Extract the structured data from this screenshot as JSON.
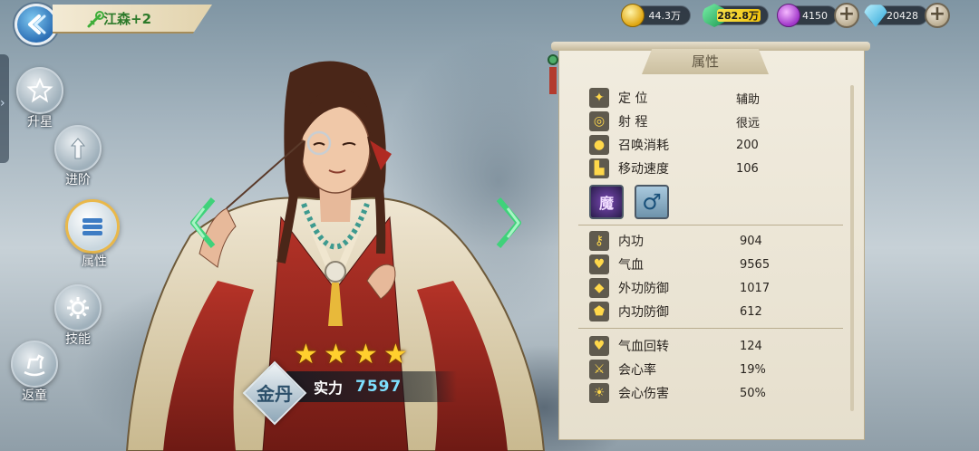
{
  "header": {
    "hero_name": "江森+2"
  },
  "currency": {
    "gold": "44.3万",
    "jade": "282.8万",
    "orb": "4150",
    "gem": "20428",
    "add_label": "+"
  },
  "side_nav": {
    "items": [
      {
        "label": "升星",
        "icon": "star-icon"
      },
      {
        "label": "进阶",
        "icon": "arrow-up-icon"
      },
      {
        "label": "属性",
        "icon": "list-icon",
        "active": true
      },
      {
        "label": "技能",
        "icon": "gear-icon"
      },
      {
        "label": "返童",
        "icon": "rocking-horse-icon"
      }
    ]
  },
  "hero": {
    "rank": "金丹",
    "stars": [
      "★",
      "★",
      "★",
      "★"
    ],
    "power_label": "实力",
    "power_value": "7597"
  },
  "panel": {
    "title": "属性",
    "basic": [
      {
        "key": "定 位",
        "value": "辅助",
        "icon": "role-icon"
      },
      {
        "key": "射 程",
        "value": "很远",
        "icon": "target-icon"
      },
      {
        "key": "召唤消耗",
        "value": "200",
        "icon": "drop-icon"
      },
      {
        "key": "移动速度",
        "value": "106",
        "icon": "boot-icon"
      }
    ],
    "tags": {
      "faction": "魔",
      "gender": "♂"
    },
    "combat": [
      {
        "key": "内功",
        "value": "904",
        "icon": "wand-icon"
      },
      {
        "key": "气血",
        "value": "9565",
        "icon": "heart-icon"
      },
      {
        "key": "外功防御",
        "value": "1017",
        "icon": "shield-icon"
      },
      {
        "key": "内功防御",
        "value": "612",
        "icon": "shield-icon"
      }
    ],
    "extra": [
      {
        "key": "气血回转",
        "value": "124",
        "icon": "heart-plus-icon"
      },
      {
        "key": "会心率",
        "value": "19%",
        "icon": "crit-icon"
      },
      {
        "key": "会心伤害",
        "value": "50%",
        "icon": "sun-icon"
      }
    ]
  },
  "colors": {
    "accent_gold": "#ffcf2e",
    "power_value": "#7ee0ff",
    "hero_name": "#2d7a2a"
  }
}
